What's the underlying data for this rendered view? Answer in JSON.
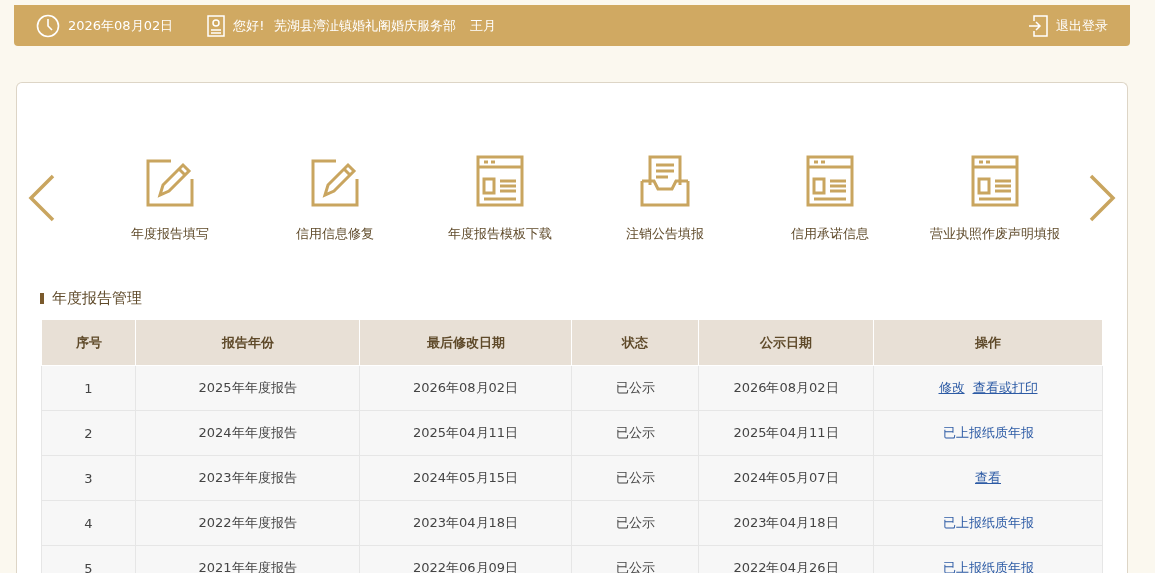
{
  "top_bar": {
    "date": "2026年08月02日",
    "greeting": "您好!",
    "company": "芜湖县湾沚镇婚礼阁婚庆服务部",
    "user": "王月",
    "logout": "退出登录"
  },
  "shortcuts": [
    {
      "label": "年度报告填写",
      "kind": "edit"
    },
    {
      "label": "信用信息修复",
      "kind": "edit"
    },
    {
      "label": "年度报告模板下载",
      "kind": "form"
    },
    {
      "label": "注销公告填报",
      "kind": "tray"
    },
    {
      "label": "信用承诺信息",
      "kind": "form"
    },
    {
      "label": "营业执照作废声明填报",
      "kind": "form"
    }
  ],
  "section_title": "年度报告管理",
  "table": {
    "columns": [
      "序号",
      "报告年份",
      "最后修改日期",
      "状态",
      "公示日期",
      "操作"
    ],
    "rows": [
      {
        "cells": [
          "1",
          "2025年年度报告",
          "2026年08月02日",
          "已公示",
          "2026年08月02日"
        ],
        "actions": [
          {
            "label": "修改",
            "kind": "link"
          },
          {
            "label": "查看或打印",
            "kind": "link"
          }
        ]
      },
      {
        "cells": [
          "2",
          "2024年年度报告",
          "2025年04月11日",
          "已公示",
          "2025年04月11日"
        ],
        "actions": [
          {
            "label": "已上报纸质年报",
            "kind": "text"
          }
        ]
      },
      {
        "cells": [
          "3",
          "2023年年度报告",
          "2024年05月15日",
          "已公示",
          "2024年05月07日"
        ],
        "actions": [
          {
            "label": "查看",
            "kind": "link"
          }
        ]
      },
      {
        "cells": [
          "4",
          "2022年年度报告",
          "2023年04月18日",
          "已公示",
          "2023年04月18日"
        ],
        "actions": [
          {
            "label": "已上报纸质年报",
            "kind": "text"
          }
        ]
      },
      {
        "cells": [
          "5",
          "2021年年度报告",
          "2022年06月09日",
          "已公示",
          "2022年04月26日"
        ],
        "actions": [
          {
            "label": "已上报纸质年报",
            "kind": "text"
          }
        ]
      }
    ]
  }
}
